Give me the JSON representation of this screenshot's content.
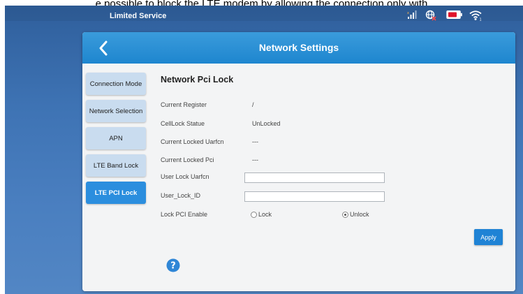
{
  "caption": "e possible to block the LTE modem by allowing the connection only with",
  "status_bar": {
    "service_text": "Limited Service",
    "icons": [
      "signal-icon",
      "globe-disconnected-icon",
      "battery-icon",
      "wifi-icon"
    ]
  },
  "panel": {
    "title": "Network Settings",
    "back_icon": "chevron-left-icon"
  },
  "sidebar": {
    "items": [
      {
        "label": "Connection Mode",
        "active": false
      },
      {
        "label": "Network Selection",
        "active": false
      },
      {
        "label": "APN",
        "active": false
      },
      {
        "label": "LTE Band Lock",
        "active": false
      },
      {
        "label": "LTE PCI Lock",
        "active": true
      }
    ]
  },
  "content": {
    "title": "Network Pci Lock",
    "rows": [
      {
        "label": "Current Register",
        "value": "/"
      },
      {
        "label": "CellLock Statue",
        "value": "UnLocked"
      },
      {
        "label": "Current Locked Uarfcn",
        "value": "---"
      },
      {
        "label": "Current Locked Pci",
        "value": "---"
      }
    ],
    "inputs": [
      {
        "label": "User Lock Uarfcn",
        "value": ""
      },
      {
        "label": "User_Lock_ID",
        "value": ""
      }
    ],
    "lock_pci": {
      "label": "Lock PCI Enable",
      "options": [
        {
          "label": "Lock",
          "checked": false
        },
        {
          "label": "Unlock",
          "checked": true
        }
      ]
    },
    "apply_label": "Apply",
    "help_icon": "question-icon"
  },
  "colors": {
    "background": "#3e73b4",
    "header": "#1e86cf",
    "accent": "#2b8ede",
    "nav_inactive": "#c9dcef",
    "battery": "#e0142b"
  }
}
